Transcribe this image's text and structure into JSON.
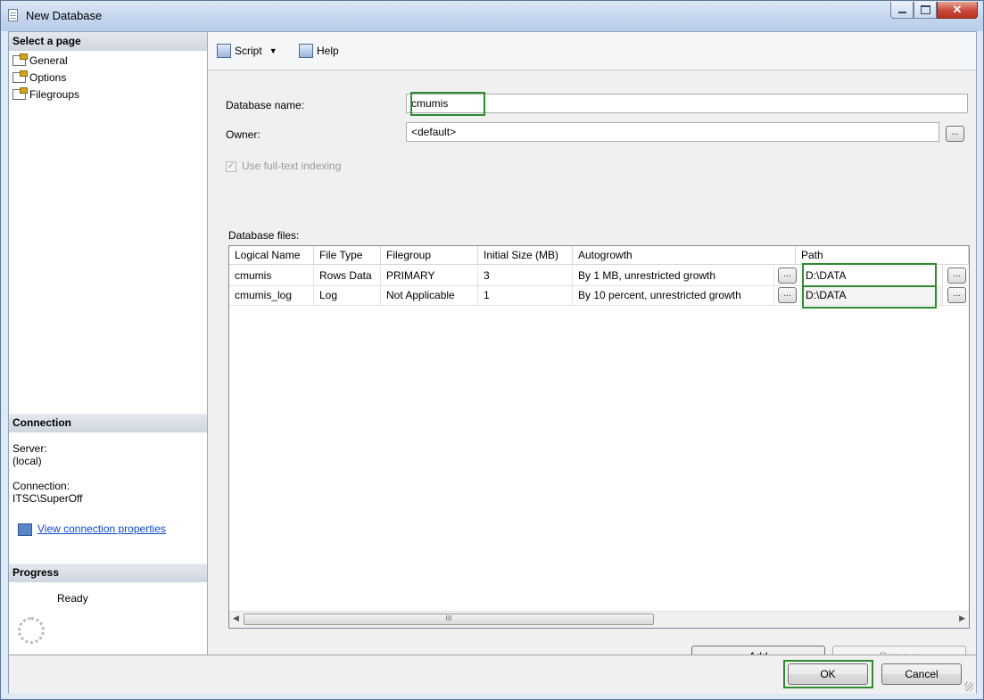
{
  "window": {
    "title": "New Database"
  },
  "sidebar": {
    "select_page_header": "Select a page",
    "pages": [
      {
        "label": "General"
      },
      {
        "label": "Options"
      },
      {
        "label": "Filegroups"
      }
    ],
    "connection_header": "Connection",
    "server_label": "Server:",
    "server_value": "(local)",
    "connection_label": "Connection:",
    "connection_value": "ITSC\\SuperOff",
    "view_connection_link": "View connection properties",
    "progress_header": "Progress",
    "progress_status": "Ready"
  },
  "toolbar": {
    "script_label": "Script",
    "help_label": "Help"
  },
  "form": {
    "database_name_label": "Database name:",
    "database_name_value": "cmumis",
    "owner_label": "Owner:",
    "owner_value": "<default>",
    "browse_label": "...",
    "fulltext_label": "Use full-text indexing",
    "database_files_label": "Database files:"
  },
  "grid": {
    "columns": [
      "Logical Name",
      "File Type",
      "Filegroup",
      "Initial Size (MB)",
      "Autogrowth",
      "Path"
    ],
    "rows": [
      {
        "logical_name": "cmumis",
        "file_type": "Rows Data",
        "filegroup": "PRIMARY",
        "initial_size": "3",
        "autogrowth": "By 1 MB, unrestricted growth",
        "path": "D:\\DATA"
      },
      {
        "logical_name": "cmumis_log",
        "file_type": "Log",
        "filegroup": "Not Applicable",
        "initial_size": "1",
        "autogrowth": "By 10 percent, unrestricted growth",
        "path": "D:\\DATA"
      }
    ],
    "scroll_grip": "III"
  },
  "buttons": {
    "add": "Add",
    "remove": "Remove",
    "ok": "OK",
    "cancel": "Cancel"
  },
  "icons": {
    "close": "close-icon",
    "maximize": "maximize-icon",
    "minimize": "minimize-icon",
    "script": "script-icon",
    "help": "help-icon",
    "page": "page-icon",
    "connection": "connection-properties-icon",
    "progress": "progress-spinner-icon"
  },
  "colors": {
    "highlight": "#2e8b2e",
    "link": "#0b47d0",
    "close_button": "#c9483a"
  }
}
